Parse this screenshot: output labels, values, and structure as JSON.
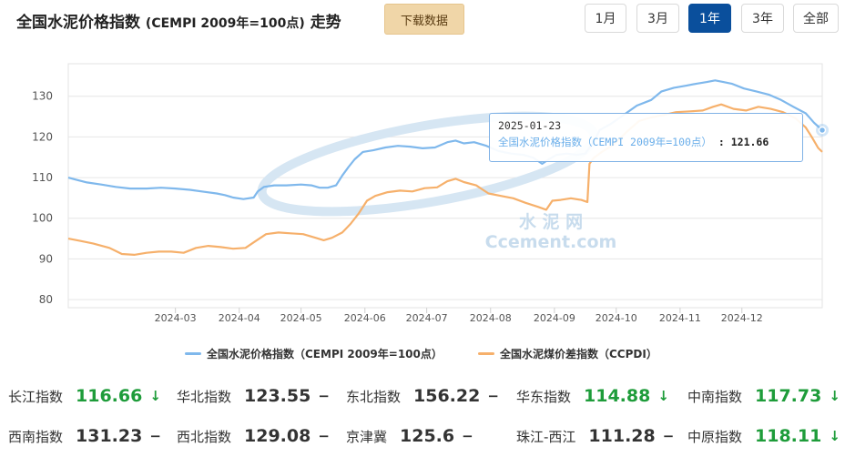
{
  "header": {
    "title_main": "全国水泥价格指数",
    "title_sub": "(CEMPI 2009年=100点)",
    "title_suffix": "走势",
    "download_label": "下载数据",
    "ranges": [
      {
        "label": "1月",
        "active": false
      },
      {
        "label": "3月",
        "active": false
      },
      {
        "label": "1年",
        "active": true
      },
      {
        "label": "3年",
        "active": false
      },
      {
        "label": "全部",
        "active": false
      }
    ]
  },
  "colors": {
    "cempi": "#7fb8ec",
    "ccpdi": "#f6b06b",
    "grid": "#e6e6e6",
    "active_btn": "#0a4f9c",
    "up": "#e03030",
    "down": "#1e9c3a",
    "watermark": "#d6e6f3"
  },
  "watermark": {
    "line1": "水  泥  网",
    "line2": "Ccement.com"
  },
  "tooltip": {
    "date": "2025-01-23",
    "series": "全国水泥价格指数（CEMPI 2009年=100点）",
    "value": "121.66"
  },
  "legend": [
    {
      "name": "全国水泥价格指数（CEMPI 2009年=100点）",
      "color": "#7fb8ec"
    },
    {
      "name": "全国水泥煤价差指数（CCPDI）",
      "color": "#f6b06b"
    }
  ],
  "chart_data": {
    "type": "line",
    "ylim": [
      78,
      138
    ],
    "yticks": [
      80,
      90,
      100,
      110,
      120,
      130
    ],
    "x_start": "2024-01-23",
    "x_end": "2025-01-23",
    "xticks": [
      "2024-03",
      "2024-04",
      "2024-05",
      "2024-06",
      "2024-07",
      "2024-08",
      "2024-09",
      "2024-10",
      "2024-11",
      "2024-12"
    ],
    "grid": true,
    "series": [
      {
        "name": "全国水泥价格指数（CEMPI 2009年=100点）",
        "points": [
          [
            "2024-01-23",
            110.0
          ],
          [
            "2024-01-26",
            109.6
          ],
          [
            "2024-02-01",
            108.8
          ],
          [
            "2024-02-08",
            108.3
          ],
          [
            "2024-02-15",
            107.7
          ],
          [
            "2024-02-22",
            107.3
          ],
          [
            "2024-03-01",
            107.3
          ],
          [
            "2024-03-08",
            107.5
          ],
          [
            "2024-03-15",
            107.3
          ],
          [
            "2024-03-22",
            107.0
          ],
          [
            "2024-03-29",
            106.5
          ],
          [
            "2024-04-04",
            106.1
          ],
          [
            "2024-04-08",
            105.7
          ],
          [
            "2024-04-12",
            105.1
          ],
          [
            "2024-04-17",
            104.7
          ],
          [
            "2024-04-22",
            105.1
          ],
          [
            "2024-04-24",
            106.6
          ],
          [
            "2024-04-27",
            107.7
          ],
          [
            "2024-05-02",
            108.1
          ],
          [
            "2024-05-08",
            108.1
          ],
          [
            "2024-05-15",
            108.3
          ],
          [
            "2024-05-20",
            108.1
          ],
          [
            "2024-05-24",
            107.5
          ],
          [
            "2024-05-28",
            107.5
          ],
          [
            "2024-06-01",
            108.1
          ],
          [
            "2024-06-04",
            110.5
          ],
          [
            "2024-06-07",
            112.6
          ],
          [
            "2024-06-10",
            114.5
          ],
          [
            "2024-06-14",
            116.3
          ],
          [
            "2024-06-19",
            116.7
          ],
          [
            "2024-06-25",
            117.4
          ],
          [
            "2024-07-01",
            117.8
          ],
          [
            "2024-07-07",
            117.6
          ],
          [
            "2024-07-13",
            117.2
          ],
          [
            "2024-07-19",
            117.4
          ],
          [
            "2024-07-25",
            118.7
          ],
          [
            "2024-07-29",
            119.1
          ],
          [
            "2024-08-02",
            118.4
          ],
          [
            "2024-08-07",
            118.7
          ],
          [
            "2024-08-13",
            117.8
          ],
          [
            "2024-08-19",
            116.5
          ],
          [
            "2024-08-25",
            115.9
          ],
          [
            "2024-08-31",
            115.6
          ],
          [
            "2024-09-05",
            114.8
          ],
          [
            "2024-09-09",
            113.4
          ],
          [
            "2024-09-12",
            114.4
          ],
          [
            "2024-09-16",
            115.6
          ],
          [
            "2024-09-21",
            115.9
          ],
          [
            "2024-09-26",
            115.6
          ],
          [
            "2024-09-30",
            115.9
          ],
          [
            "2024-10-04",
            118.7
          ],
          [
            "2024-10-07",
            121.7
          ],
          [
            "2024-10-12",
            123.1
          ],
          [
            "2024-10-18",
            125.2
          ],
          [
            "2024-10-25",
            127.7
          ],
          [
            "2024-11-01",
            129.1
          ],
          [
            "2024-11-06",
            131.2
          ],
          [
            "2024-11-12",
            132.1
          ],
          [
            "2024-11-18",
            132.6
          ],
          [
            "2024-11-23",
            133.1
          ],
          [
            "2024-11-28",
            133.5
          ],
          [
            "2024-12-02",
            133.9
          ],
          [
            "2024-12-06",
            133.5
          ],
          [
            "2024-12-10",
            133.1
          ],
          [
            "2024-12-16",
            131.9
          ],
          [
            "2024-12-22",
            131.2
          ],
          [
            "2024-12-28",
            130.4
          ],
          [
            "2025-01-03",
            129.1
          ],
          [
            "2025-01-09",
            127.4
          ],
          [
            "2025-01-15",
            125.8
          ],
          [
            "2025-01-19",
            123.5
          ],
          [
            "2025-01-23",
            121.66
          ]
        ]
      },
      {
        "name": "全国水泥煤价差指数（CCPDI）",
        "points": [
          [
            "2024-01-23",
            95.0
          ],
          [
            "2024-01-29",
            94.4
          ],
          [
            "2024-02-04",
            93.8
          ],
          [
            "2024-02-12",
            92.7
          ],
          [
            "2024-02-18",
            91.2
          ],
          [
            "2024-02-24",
            91.0
          ],
          [
            "2024-03-01",
            91.5
          ],
          [
            "2024-03-07",
            91.8
          ],
          [
            "2024-03-13",
            91.8
          ],
          [
            "2024-03-19",
            91.5
          ],
          [
            "2024-03-25",
            92.7
          ],
          [
            "2024-03-31",
            93.2
          ],
          [
            "2024-04-06",
            92.9
          ],
          [
            "2024-04-12",
            92.5
          ],
          [
            "2024-04-18",
            92.7
          ],
          [
            "2024-04-23",
            94.4
          ],
          [
            "2024-04-28",
            96.1
          ],
          [
            "2024-05-04",
            96.5
          ],
          [
            "2024-05-10",
            96.3
          ],
          [
            "2024-05-16",
            96.1
          ],
          [
            "2024-05-22",
            95.2
          ],
          [
            "2024-05-26",
            94.6
          ],
          [
            "2024-05-30",
            95.2
          ],
          [
            "2024-06-04",
            96.5
          ],
          [
            "2024-06-08",
            98.6
          ],
          [
            "2024-06-12",
            101.2
          ],
          [
            "2024-06-16",
            104.3
          ],
          [
            "2024-06-20",
            105.5
          ],
          [
            "2024-06-26",
            106.4
          ],
          [
            "2024-07-02",
            106.8
          ],
          [
            "2024-07-08",
            106.6
          ],
          [
            "2024-07-14",
            107.4
          ],
          [
            "2024-07-20",
            107.6
          ],
          [
            "2024-07-25",
            109.1
          ],
          [
            "2024-07-29",
            109.7
          ],
          [
            "2024-08-02",
            108.9
          ],
          [
            "2024-08-08",
            108.1
          ],
          [
            "2024-08-14",
            106.1
          ],
          [
            "2024-08-20",
            105.5
          ],
          [
            "2024-08-26",
            104.9
          ],
          [
            "2024-09-01",
            103.8
          ],
          [
            "2024-09-07",
            102.8
          ],
          [
            "2024-09-11",
            102.1
          ],
          [
            "2024-09-14",
            104.3
          ],
          [
            "2024-09-18",
            104.5
          ],
          [
            "2024-09-23",
            104.9
          ],
          [
            "2024-09-28",
            104.5
          ],
          [
            "2024-10-01",
            104.0
          ],
          [
            "2024-10-02",
            113.4
          ],
          [
            "2024-10-04",
            114.8
          ],
          [
            "2024-10-08",
            116.3
          ],
          [
            "2024-10-14",
            118.2
          ],
          [
            "2024-10-20",
            121.2
          ],
          [
            "2024-10-26",
            123.9
          ],
          [
            "2024-11-01",
            124.8
          ],
          [
            "2024-11-07",
            125.4
          ],
          [
            "2024-11-13",
            126.1
          ],
          [
            "2024-11-20",
            126.3
          ],
          [
            "2024-11-26",
            126.5
          ],
          [
            "2024-12-01",
            127.4
          ],
          [
            "2024-12-05",
            128.0
          ],
          [
            "2024-12-11",
            126.9
          ],
          [
            "2024-12-17",
            126.5
          ],
          [
            "2024-12-23",
            127.4
          ],
          [
            "2024-12-29",
            126.9
          ],
          [
            "2025-01-04",
            126.1
          ],
          [
            "2025-01-10",
            124.6
          ],
          [
            "2025-01-15",
            122.3
          ],
          [
            "2025-01-18",
            119.9
          ],
          [
            "2025-01-21",
            117.3
          ],
          [
            "2025-01-23",
            116.3
          ]
        ]
      }
    ]
  },
  "indices": [
    [
      {
        "name": "长江指数",
        "value": "116.66",
        "trend": "down",
        "arrow": "↓"
      },
      {
        "name": "华北指数",
        "value": "123.55",
        "trend": "flat",
        "arrow": "−"
      },
      {
        "name": "东北指数",
        "value": "156.22",
        "trend": "flat",
        "arrow": "−"
      },
      {
        "name": "华东指数",
        "value": "114.88",
        "trend": "down",
        "arrow": "↓"
      },
      {
        "name": "中南指数",
        "value": "117.73",
        "trend": "down",
        "arrow": "↓"
      }
    ],
    [
      {
        "name": "西南指数",
        "value": "131.23",
        "trend": "flat",
        "arrow": "−"
      },
      {
        "name": "西北指数",
        "value": "129.08",
        "trend": "flat",
        "arrow": "−"
      },
      {
        "name": "京津冀",
        "value": "125.6",
        "trend": "flat",
        "arrow": "−"
      },
      {
        "name": "珠江-西江",
        "value": "111.28",
        "trend": "flat",
        "arrow": "−"
      },
      {
        "name": "中原指数",
        "value": "118.11",
        "trend": "down",
        "arrow": "↓"
      }
    ]
  ]
}
